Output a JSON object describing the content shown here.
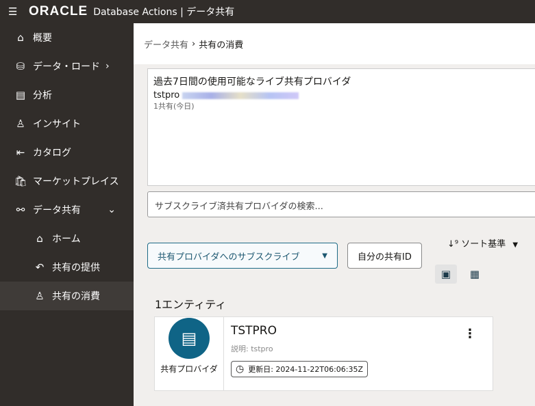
{
  "header": {
    "logo": "ORACLE",
    "title": "Database Actions | データ共有"
  },
  "sidebar": {
    "items": [
      {
        "label": "概要",
        "icon": "home-icon"
      },
      {
        "label": "データ・ロード",
        "icon": "database-upload-icon"
      },
      {
        "label": "分析",
        "icon": "analysis-icon"
      },
      {
        "label": "インサイト",
        "icon": "insight-icon"
      },
      {
        "label": "カタログ",
        "icon": "catalog-icon"
      },
      {
        "label": "マーケットプレイス",
        "icon": "marketplace-icon"
      },
      {
        "label": "データ共有",
        "icon": "share-icon"
      },
      {
        "label": "ホーム",
        "icon": "home-icon"
      },
      {
        "label": "共有の提供",
        "icon": "reply-icon"
      },
      {
        "label": "共有の消費",
        "icon": "user-icon"
      }
    ]
  },
  "breadcrumb": {
    "parent": "データ共有",
    "current": "共有の消費"
  },
  "providers_box": {
    "title": "過去7日間の使用可能なライブ共有プロバイダ",
    "provider": "tstpro",
    "count_text": "1共有(今日)"
  },
  "search": {
    "placeholder": "サブスクライブ済共有プロバイダの検索..."
  },
  "buttons": {
    "subscribe": "共有プロバイダへのサブスクライブ",
    "my_share_id": "自分の共有ID",
    "sort": "ソート基準"
  },
  "results": {
    "count": "1エンティティ"
  },
  "card": {
    "type": "共有プロバイダ",
    "name": "TSTPRO",
    "description": "説明: tstpro",
    "updated": "更新日: 2024-11-22T06:06:35Z"
  },
  "colors": {
    "header": "#312d2a",
    "accent": "#0f6486"
  }
}
